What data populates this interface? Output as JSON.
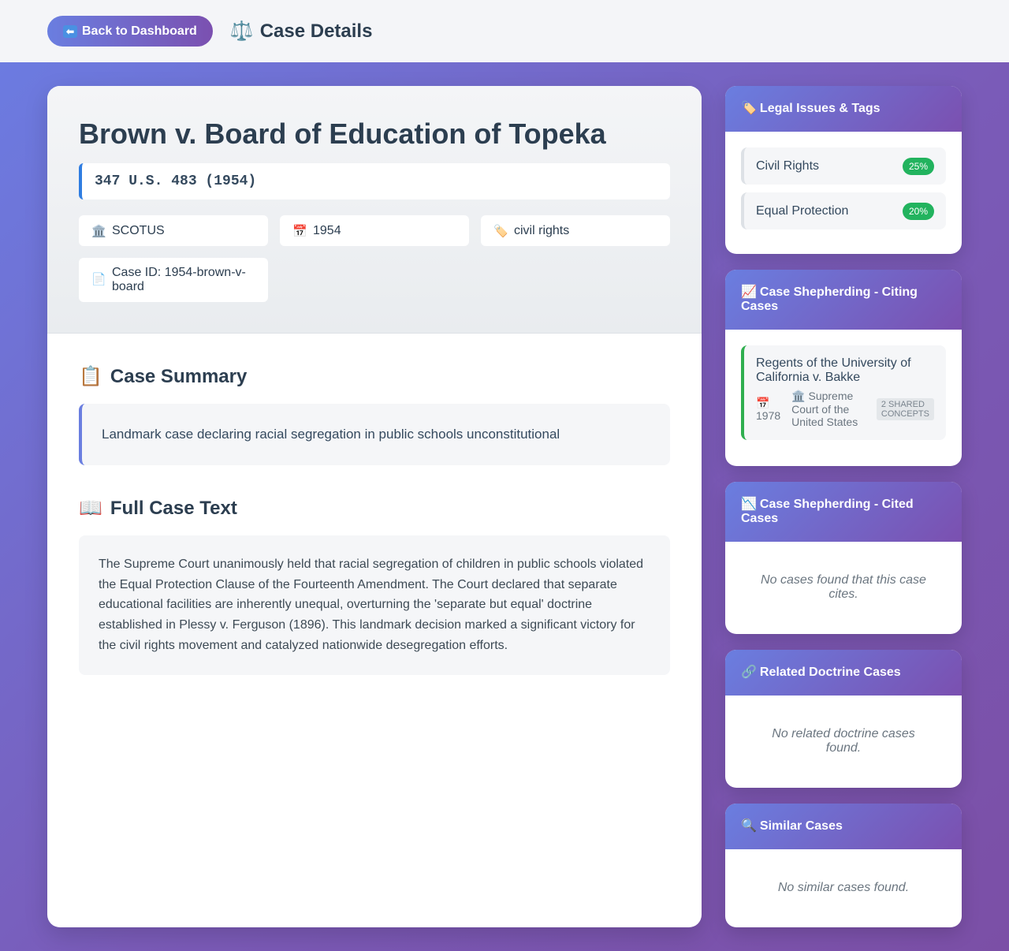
{
  "topbar": {
    "back_label": "Back to Dashboard",
    "back_icon": "left-arrow-icon",
    "title": "Case Details",
    "title_icon": "⚖️"
  },
  "case": {
    "title": "Brown v. Board of Education of Topeka",
    "citation": "347 U.S. 483 (1954)",
    "court": "SCOTUS",
    "year": "1954",
    "category": "civil rights",
    "case_id": "Case ID: 1954-brown-v-board",
    "summary_title": "Case Summary",
    "summary": "Landmark case declaring racial segregation in public schools unconstitutional",
    "fulltext_title": "Full Case Text",
    "fulltext": "The Supreme Court unanimously held that racial segregation of children in public schools violated the Equal Protection Clause of the Fourteenth Amendment. The Court declared that separate educational facilities are inherently unequal, overturning the 'separate but equal' doctrine established in Plessy v. Ferguson (1896). This landmark decision marked a significant victory for the civil rights movement and catalyzed nationwide desegregation efforts."
  },
  "sidebar": {
    "tags": {
      "title": "Legal Issues & Tags",
      "items": [
        {
          "label": "Civil Rights",
          "score": "25%"
        },
        {
          "label": "Equal Protection",
          "score": "20%"
        }
      ]
    },
    "citing": {
      "title": "Case Shepherding - Citing Cases",
      "items": [
        {
          "name": "Regents of the University of California v. Bakke",
          "year": "1978",
          "court": "Supreme Court of the United States",
          "concepts": "2 shared concepts"
        }
      ]
    },
    "cited": {
      "title": "Case Shepherding - Cited Cases",
      "empty": "No cases found that this case cites."
    },
    "doctrine": {
      "title": "Related Doctrine Cases",
      "empty": "No related doctrine cases found."
    },
    "similar": {
      "title": "Similar Cases",
      "empty": "No similar cases found."
    }
  },
  "colors": {
    "accent": "#6a7ee0",
    "accent_purple": "#7b50b0",
    "badge_green": "#22b35e",
    "citation_bar": "#2f7de1",
    "citing_bar": "#2fae4f"
  }
}
